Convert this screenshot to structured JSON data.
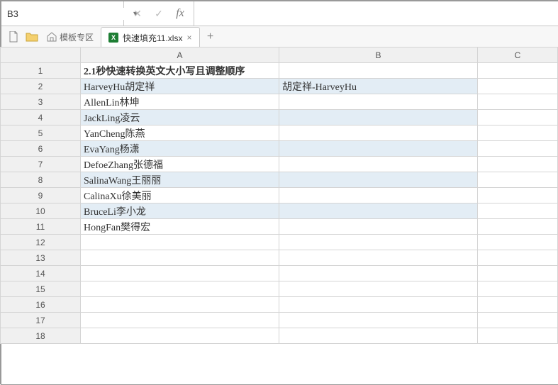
{
  "nameBox": {
    "value": "B3"
  },
  "formulaBar": {
    "cancel": "✕",
    "confirm": "✓",
    "fx": "fx",
    "value": ""
  },
  "tabbar": {
    "templateLabel": "模板专区",
    "fileIcon": "X",
    "fileTab": "快速填充11.xlsx",
    "close": "×",
    "add": "+"
  },
  "columns": [
    "A",
    "B",
    "C"
  ],
  "rowCount": 18,
  "title": "2.1秒快速转换英文大小写且调整顺序",
  "rows": [
    {
      "a": "HarveyHu胡定祥",
      "b": "胡定祥-HarveyHu"
    },
    {
      "a": "AllenLin林坤",
      "b": ""
    },
    {
      "a": "JackLing凌云",
      "b": ""
    },
    {
      "a": "YanCheng陈燕",
      "b": ""
    },
    {
      "a": "EvaYang杨潇",
      "b": ""
    },
    {
      "a": "DefoeZhang张德福",
      "b": ""
    },
    {
      "a": "SalinaWang王丽丽",
      "b": ""
    },
    {
      "a": "CalinaXu徐美丽",
      "b": ""
    },
    {
      "a": "BruceLi李小龙",
      "b": ""
    },
    {
      "a": "HongFan樊得宏",
      "b": ""
    }
  ]
}
